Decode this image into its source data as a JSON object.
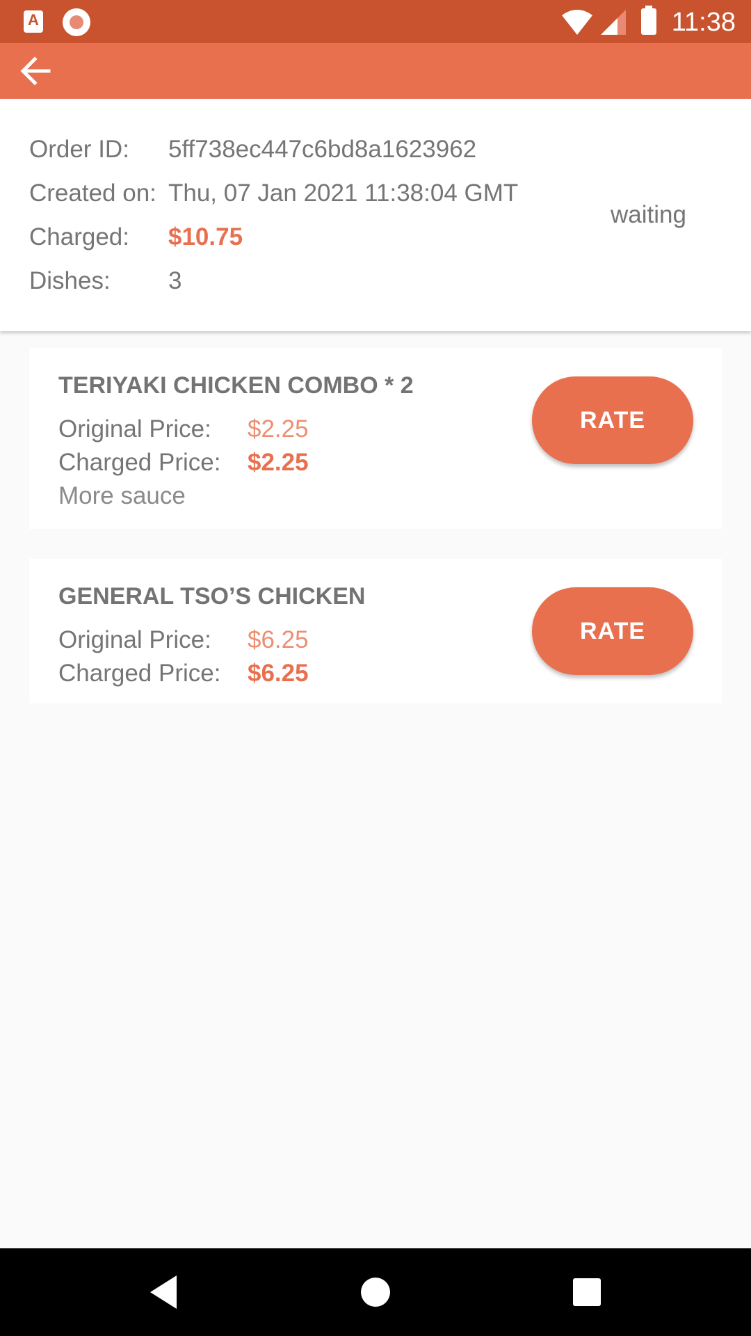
{
  "status_bar": {
    "time": "11:38",
    "icons": [
      "app-a-icon",
      "record-icon",
      "wifi-icon",
      "signal-icon",
      "battery-icon"
    ]
  },
  "app_bar": {
    "back_icon": "arrow-left-icon"
  },
  "order": {
    "id_label": "Order ID:",
    "id_value": "5ff738ec447c6bd8a1623962",
    "created_label": "Created on:",
    "created_value": "Thu, 07 Jan 2021 11:38:04 GMT",
    "charged_label": "Charged:",
    "charged_value": "$10.75",
    "dishes_label": "Dishes:",
    "dishes_value": "3",
    "status": "waiting"
  },
  "dishes": [
    {
      "name": "TERIYAKI CHICKEN COMBO * 2",
      "original_label": "Original Price:",
      "original_price": "$2.25",
      "charged_label": "Charged Price:",
      "charged_price": "$2.25",
      "note": "More sauce",
      "rate_label": "RATE"
    },
    {
      "name": "GENERAL TSO’S CHICKEN",
      "original_label": "Original Price:",
      "original_price": "$6.25",
      "charged_label": "Charged Price:",
      "charged_price": "$6.25",
      "rate_label": "RATE"
    }
  ],
  "colors": {
    "status_bar": "#c8532e",
    "app_bar": "#e8704f",
    "accent": "#e8704f",
    "accent_light": "#ec8e71",
    "text": "#757575",
    "background": "#fafafa"
  },
  "nav_bar": {
    "icons": [
      "nav-back-icon",
      "nav-home-icon",
      "nav-recents-icon"
    ]
  }
}
